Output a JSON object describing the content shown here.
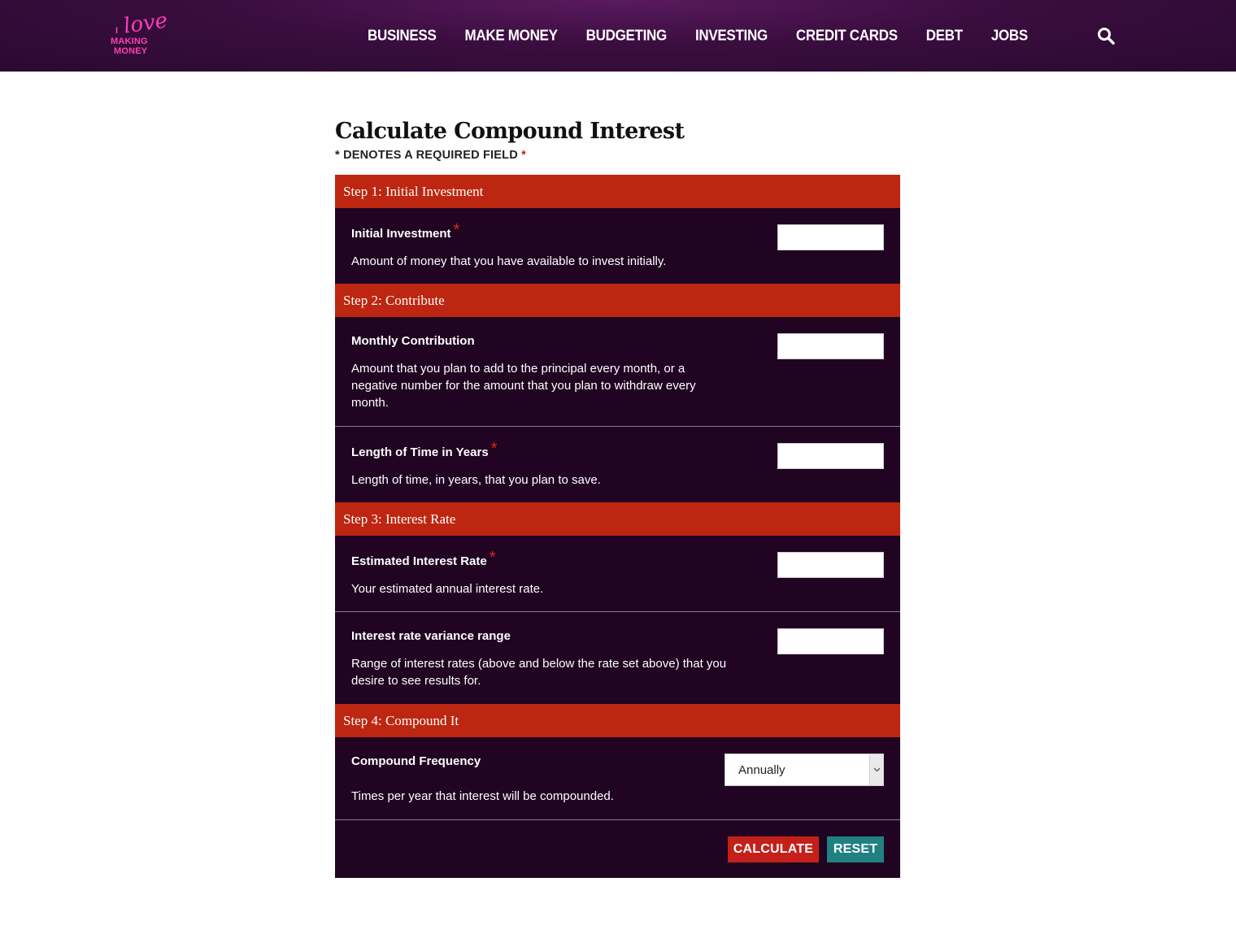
{
  "header": {
    "logo": {
      "line1": "I",
      "line2": "love",
      "line3": "MAKING",
      "line4": "MONEY"
    },
    "nav": [
      "BUSINESS",
      "MAKE MONEY",
      "BUDGETING",
      "INVESTING",
      "CREDIT CARDS",
      "DEBT",
      "JOBS"
    ],
    "search_icon": "search-icon"
  },
  "page": {
    "title": "Calculate Compound Interest",
    "required_note": "* DENOTES A REQUIRED FIELD",
    "required_star": "*"
  },
  "form": {
    "step1": {
      "heading": "Step 1: Initial Investment",
      "initial_investment": {
        "label": "Initial Investment",
        "required": "*",
        "desc": "Amount of money that you have available to invest initially.",
        "value": ""
      }
    },
    "step2": {
      "heading": "Step 2: Contribute",
      "monthly_contribution": {
        "label": "Monthly Contribution",
        "desc": "Amount that you plan to add to the principal every month, or a negative number for the amount that you plan to withdraw every month.",
        "value": ""
      },
      "length_of_time": {
        "label": "Length of Time in Years",
        "required": "*",
        "desc": "Length of time, in years, that you plan to save.",
        "value": ""
      }
    },
    "step3": {
      "heading": "Step 3: Interest Rate",
      "estimated_rate": {
        "label": "Estimated Interest Rate",
        "required": "*",
        "desc": "Your estimated annual interest rate.",
        "value": ""
      },
      "variance_range": {
        "label": "Interest rate variance range",
        "desc": "Range of interest rates (above and below the rate set above) that you desire to see results for.",
        "value": ""
      }
    },
    "step4": {
      "heading": "Step 4: Compound It",
      "compound_frequency": {
        "label": "Compound Frequency",
        "desc": "Times per year that interest will be compounded.",
        "selected": "Annually"
      }
    },
    "buttons": {
      "calculate": "CALCULATE",
      "reset": "RESET"
    }
  },
  "colors": {
    "header_bg": "#3a0d3f",
    "step_header": "#bd2610",
    "form_bg": "#200422",
    "calculate_btn": "#c4201a",
    "reset_btn": "#1f8180",
    "required_star": "#e0281e",
    "logo_pink": "#ff3db4"
  }
}
